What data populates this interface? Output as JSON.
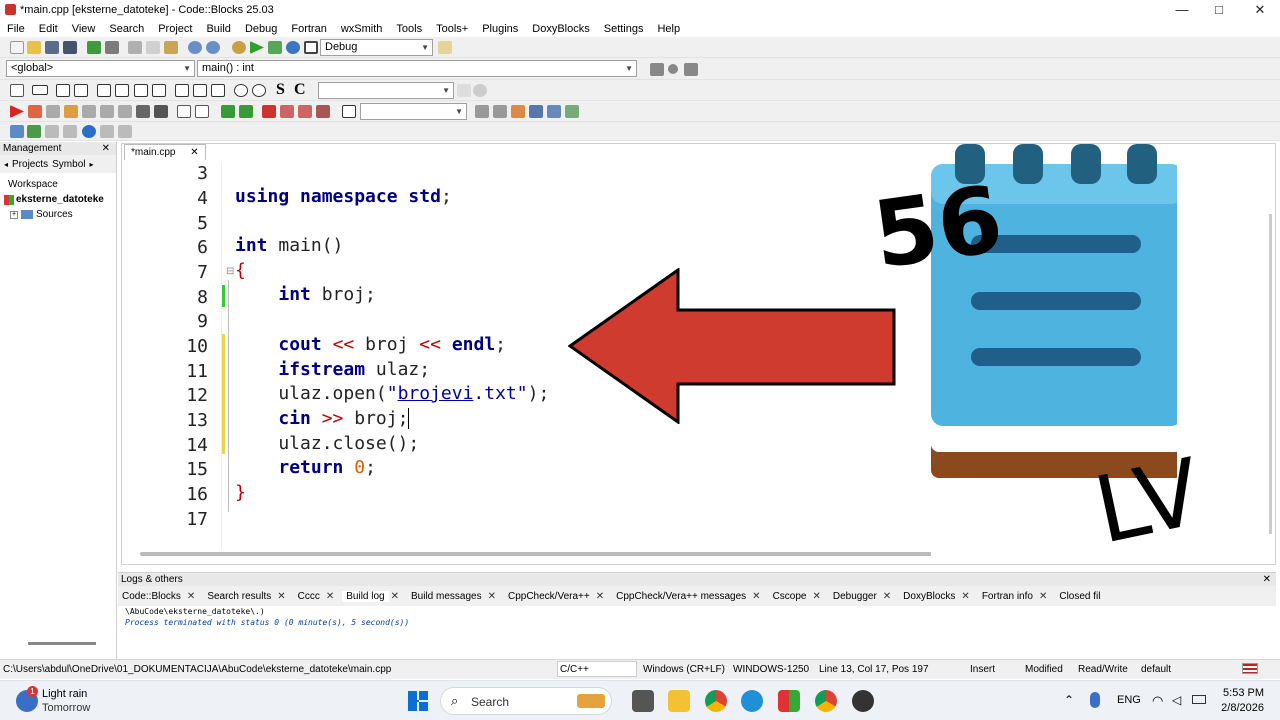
{
  "window": {
    "title": "*main.cpp [eksterne_datoteke] - Code::Blocks 25.03",
    "minimize": "—",
    "maximize": "□",
    "close": "✕"
  },
  "menu": [
    "File",
    "Edit",
    "View",
    "Search",
    "Project",
    "Build",
    "Debug",
    "Fortran",
    "wxSmith",
    "Tools",
    "Tools+",
    "Plugins",
    "DoxyBlocks",
    "Settings",
    "Help"
  ],
  "toolbar": {
    "build_target": "Debug",
    "scope": "<global>",
    "function": "main() : int",
    "font_s": "S",
    "font_c": "C"
  },
  "management": {
    "title": "Management",
    "close": "✕",
    "tabs": [
      "Projects",
      "Symbol"
    ],
    "workspace": "Workspace",
    "project": "eksterne_datoteke",
    "folder": "Sources"
  },
  "editor": {
    "tab": "*main.cpp",
    "tab_close": "✕",
    "line_numbers": [
      "3",
      "4",
      "5",
      "6",
      "7",
      "8",
      "9",
      "10",
      "11",
      "12",
      "13",
      "14",
      "15",
      "16",
      "17"
    ]
  },
  "overlay": {
    "number": "56",
    "letters": "LV"
  },
  "logs": {
    "title": "Logs & others",
    "close": "✕",
    "tabs": [
      "Code::Blocks",
      "Search results",
      "Cccc",
      "Build log",
      "Build messages",
      "CppCheck/Vera++",
      "CppCheck/Vera++ messages",
      "Cscope",
      "Debugger",
      "DoxyBlocks",
      "Fortran info",
      "Closed fil"
    ],
    "output": [
      "\\AbuCode\\eksterne_datoteke\\.)",
      "Process terminated with status 0 (0 minute(s), 5 second(s))"
    ]
  },
  "status": {
    "path": "C:\\Users\\abdul\\OneDrive\\01_DOKUMENTACIJA\\AbuCode\\eksterne_datoteke\\main.cpp",
    "lang": "C/C++",
    "eol": "Windows (CR+LF)",
    "enc": "WINDOWS-1250",
    "pos": "Line 13, Col 17, Pos 197",
    "mode": "Insert",
    "modified": "Modified",
    "rw": "Read/Write",
    "profile": "default"
  },
  "taskbar": {
    "weather": "Light rain",
    "weather_sub": "Tomorrow",
    "weather_badge": "1",
    "search": "Search",
    "lang": "ENG",
    "time": "5:53 PM",
    "date": "2/8/2026"
  }
}
